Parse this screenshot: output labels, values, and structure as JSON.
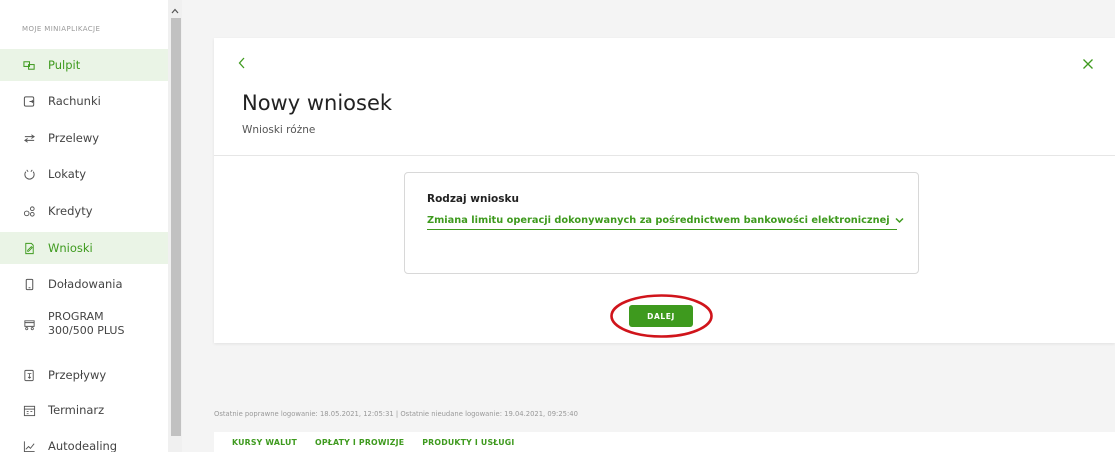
{
  "sidebar": {
    "heading": "MOJE MINIAPLIKACJE",
    "items": [
      {
        "label": "Pulpit",
        "icon": "dashboard-icon",
        "active": true
      },
      {
        "label": "Rachunki",
        "icon": "accounts-icon",
        "active": false
      },
      {
        "label": "Przelewy",
        "icon": "transfer-arrows-icon",
        "active": false
      },
      {
        "label": "Lokaty",
        "icon": "savings-icon",
        "active": false
      },
      {
        "label": "Kredyty",
        "icon": "credit-icon",
        "active": false
      },
      {
        "label": "Wnioski",
        "icon": "document-pen-icon",
        "active": true
      },
      {
        "label": "Doładowania",
        "icon": "phone-icon",
        "active": false
      },
      {
        "label": "PROGRAM 300/500 PLUS",
        "icon": "stroller-icon",
        "active": false
      },
      {
        "label": "Przepływy",
        "icon": "flows-icon",
        "active": false
      },
      {
        "label": "Terminarz",
        "icon": "calendar-icon",
        "active": false
      },
      {
        "label": "Autodealing",
        "icon": "chart-line-icon",
        "active": false
      }
    ]
  },
  "card": {
    "title": "Nowy wniosek",
    "subtitle": "Wnioski różne",
    "field_label": "Rodzaj wniosku",
    "field_value": "Zmiana limitu operacji dokonywanych za pośrednictwem bankowości elektronicznej",
    "next_label": "DALEJ"
  },
  "footer": {
    "login_info": "Ostatnie poprawne logowanie: 18.05.2021, 12:05:31  |  Ostatnie nieudane logowanie: 19.04.2021, 09:25:40",
    "links": [
      "KURSY WALUT",
      "OPŁATY I PROWIZJE",
      "PRODUKTY I USŁUGI"
    ]
  },
  "colors": {
    "accent": "#3e9a1e",
    "active_bg": "#eaf4e6",
    "highlight_ring": "#d0141b"
  }
}
